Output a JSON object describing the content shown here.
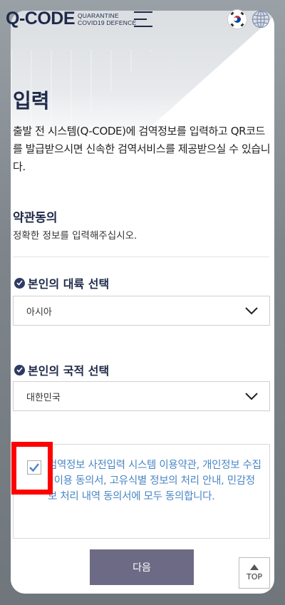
{
  "header": {
    "logo_main": "Q-CODE",
    "logo_sub_line1": "QUARANTINE",
    "logo_sub_line2": "COVID19 DEFENCE",
    "menu_icon": "hamburger-menu-icon",
    "language_flag_icon": "korea-flag-icon",
    "globe_icon": "globe-icon"
  },
  "page": {
    "title": "입력",
    "description": "출발 전 시스템(Q-CODE)에 검역정보를 입력하고 QR코드를 발급받으시면 신속한 검역서비스를 제공받으실 수 있습니다."
  },
  "terms": {
    "title": "약관동의",
    "subtitle": "정확한 정보를 입력해주십시오."
  },
  "continent": {
    "label": "본인의 대륙 선택",
    "selected": "아시아"
  },
  "nationality": {
    "label": "본인의 국적 선택",
    "selected": "대한민국"
  },
  "agreement": {
    "checked": true,
    "text": "검역정보 사전입력 시스템 이용약관, 개인정보 수집 · 이용 동의서, 고유식별 정보의 처리 안내, 민감정보 처리 내역 동의서에 모두 동의합니다."
  },
  "buttons": {
    "next_label": "다음",
    "top_label": "TOP"
  },
  "colors": {
    "brand_navy": "#1f2a4a",
    "next_button": "#6c6a84",
    "agreement_text": "#4a86c5",
    "highlight": "#ff0000"
  }
}
